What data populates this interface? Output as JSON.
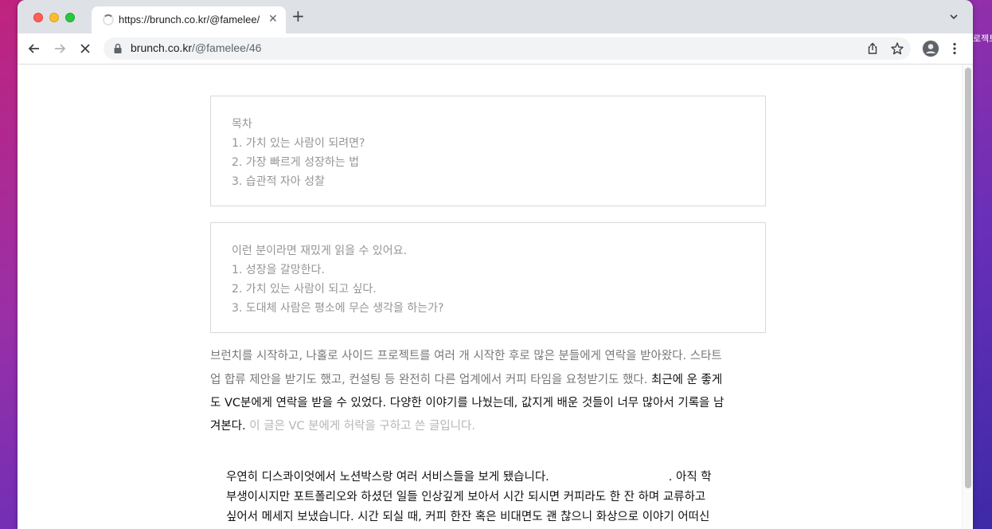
{
  "desktop": {
    "label": "로젝트"
  },
  "tab": {
    "title": "https://brunch.co.kr/@famelee/",
    "close": "✕",
    "new": "+"
  },
  "address": {
    "domain": "brunch.co.kr",
    "path": "/@famelee/46"
  },
  "toc": {
    "heading": "목차",
    "items": [
      "1. 가치 있는 사람이 되려면?",
      "2. 가장 빠르게 성장하는 법",
      "3. 습관적 자아 성찰"
    ]
  },
  "audience": {
    "heading": "이런 분이라면 재밌게 읽을 수 있어요.",
    "items": [
      "1. 성장을 갈망한다.",
      "2. 가치 있는 사람이 되고 싶다.",
      "3. 도대체 사람은 평소에 무슨 생각을 하는가?"
    ]
  },
  "intro": {
    "line1": " 브런치를 시작하고, 나홀로 사이드 프로젝트를 여러 개 시작한 후로 많은 분들에게 연락을 받아왔다. 스타트",
    "line2_a": "업 합류 제안을 받기도 했고, 컨설팅 등 완전히 다른 업계에서 커피 타임을 요청받기도 했다. ",
    "line2_b": "최근에 운 좋게",
    "line3": "도 VC분에게 연락을 받을 수 있었다. 다양한 이야기를 나눴는데, 값지게 배운 것들이 너무 많아서 기록을 남",
    "line4_a": "겨본다.",
    "line4_b": " 이 글은 VC 분에게 허락을 구하고 쓴 글입니다."
  },
  "quote": {
    "line1_a": "우연히 디스콰이엇에서 노션박스랑 여러 서비스들을 보게 됐습니다.",
    "line1_b": ". 아직 학",
    "line2": "부생이시지만 포트폴리오와 하셨던 일들 인상깊게 보아서 시간 되시면 커피라도 한 잔 하며 교류하고",
    "line3": "싶어서 메세지 보냈습니다. 시간 되실 때, 커피 한잔 혹은 비대면도 괜 찮으니 화상으로 이야기 어떠신"
  }
}
